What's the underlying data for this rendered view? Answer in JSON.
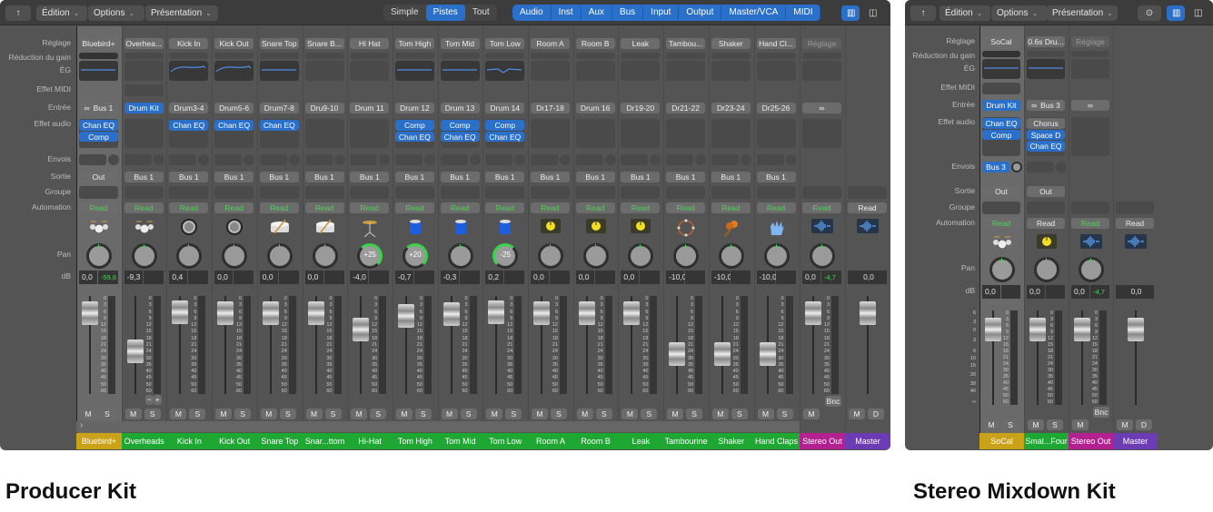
{
  "colors": {
    "accent": "#2a6fc9",
    "read_green": "#52d05a",
    "track_green": "#1fa733",
    "selected_gold": "#c9a21a",
    "output_magenta": "#b3208f",
    "master_purple": "#6c3cb4"
  },
  "row_labels": {
    "setting": "Réglage",
    "gain": "Réduction du gain",
    "eq": "ÉG",
    "midi": "Effet MIDI",
    "input": "Entrée",
    "fx": "Effet audio",
    "sends": "Envois",
    "output": "Sortie",
    "group": "Groupe",
    "automation": "Automation",
    "pan": "Pan",
    "db": "dB"
  },
  "meter_scale": [
    "0",
    "3",
    "6",
    "9",
    "12",
    "15",
    "18",
    "21",
    "24",
    "30",
    "35",
    "40",
    "45",
    "50",
    "60"
  ],
  "fader_scale": [
    "6",
    "3",
    "0",
    "3",
    "6",
    "10",
    "15",
    "20",
    "30",
    "40",
    "∞"
  ],
  "producer": {
    "caption": "Producer Kit",
    "toolbar": {
      "back_icon": "back-arrow-icon",
      "menus": [
        "Édition",
        "Options",
        "Présentation"
      ],
      "views": [
        "Simple",
        "Pistes",
        "Tout"
      ],
      "active_view": "Pistes",
      "filters": [
        "Audio",
        "Inst",
        "Aux",
        "Bus",
        "Input",
        "Output",
        "Master/VCA",
        "MIDI"
      ]
    },
    "pm_buttons": [
      "−",
      "+"
    ],
    "expand_icon": "›",
    "strips": [
      {
        "name": "Bluebird+",
        "setting": "Bluebird+",
        "eq": "flat",
        "input": "Bus 1",
        "link": true,
        "fx": [
          {
            "l": "Chan EQ",
            "b": 1
          },
          {
            "l": "Comp",
            "b": 1
          }
        ],
        "sends": true,
        "output": "Out",
        "auto": "Read",
        "icon": "drum-kit",
        "db": "0,0",
        "peak": "-59,6",
        "fader": 0,
        "btns": [
          "M",
          "S"
        ],
        "color": "#c9a21a",
        "sel": true
      },
      {
        "name": "Overheads",
        "setting": "Overhea...",
        "midi": true,
        "input": "Drum Kit",
        "inputBlue": true,
        "fx": [],
        "sends": true,
        "output": "Bus 1",
        "auto": "Read",
        "icon": "drum-kit",
        "db": "-9,3",
        "fader": -9.3,
        "btns": [
          "M",
          "S"
        ],
        "color": "#1fa733",
        "pm": true
      },
      {
        "name": "Kick In",
        "setting": "Kick In",
        "eq": "curve",
        "input": "Drum3-4",
        "fx": [
          {
            "l": "Chan EQ",
            "b": 1
          }
        ],
        "sends": true,
        "output": "Bus 1",
        "auto": "Read",
        "icon": "kick-drum",
        "db": "0,4",
        "fader": 0.4,
        "btns": [
          "M",
          "S"
        ],
        "color": "#1fa733"
      },
      {
        "name": "Kick Out",
        "setting": "Kick Out",
        "eq": "curve",
        "input": "Drum5-6",
        "fx": [
          {
            "l": "Chan EQ",
            "b": 1
          }
        ],
        "sends": true,
        "output": "Bus 1",
        "auto": "Read",
        "icon": "kick-drum",
        "db": "0,0",
        "fader": 0,
        "btns": [
          "M",
          "S"
        ],
        "color": "#1fa733"
      },
      {
        "name": "Snare Top",
        "setting": "Snare Top",
        "eq": "flat",
        "input": "Drum7-8",
        "fx": [
          {
            "l": "Chan EQ",
            "b": 1
          }
        ],
        "sends": true,
        "output": "Bus 1",
        "auto": "Read",
        "icon": "snare-drum",
        "db": "0,0",
        "fader": 0,
        "btns": [
          "M",
          "S"
        ],
        "color": "#1fa733"
      },
      {
        "name": "Snar...ttom",
        "setting": "Snare B...",
        "input": "Dru9-10",
        "fx": [],
        "sends": true,
        "output": "Bus 1",
        "auto": "Read",
        "icon": "snare-drum",
        "db": "0,0",
        "fader": 0,
        "btns": [
          "M",
          "S"
        ],
        "color": "#1fa733"
      },
      {
        "name": "Hi-Hat",
        "setting": "Hi Hat",
        "input": "Drum 11",
        "fx": [],
        "sends": true,
        "output": "Bus 1",
        "auto": "Read",
        "icon": "hi-hat",
        "pan": 25,
        "panLabel": "+25",
        "db": "-4,0",
        "fader": -4,
        "btns": [
          "M",
          "S"
        ],
        "color": "#1fa733"
      },
      {
        "name": "Tom High",
        "setting": "Tom High",
        "eq": "flat",
        "input": "Drum 12",
        "fx": [
          {
            "l": "Comp",
            "b": 1
          },
          {
            "l": "Chan EQ",
            "b": 1
          }
        ],
        "sends": true,
        "output": "Bus 1",
        "auto": "Read",
        "icon": "tom",
        "pan": 20,
        "panLabel": "+20",
        "db": "-0,7",
        "fader": -0.7,
        "btns": [
          "M",
          "S"
        ],
        "color": "#1fa733"
      },
      {
        "name": "Tom Mid",
        "setting": "Tom Mid",
        "eq": "flat",
        "input": "Drum 13",
        "fx": [
          {
            "l": "Comp",
            "b": 1
          },
          {
            "l": "Chan EQ",
            "b": 1
          }
        ],
        "sends": true,
        "output": "Bus 1",
        "auto": "Read",
        "icon": "tom",
        "db": "-0,3",
        "fader": -0.3,
        "btns": [
          "M",
          "S"
        ],
        "color": "#1fa733"
      },
      {
        "name": "Tom Low",
        "setting": "Tom Low",
        "eq": "dip",
        "input": "Drum 14",
        "fx": [
          {
            "l": "Comp",
            "b": 1
          },
          {
            "l": "Chan EQ",
            "b": 1
          }
        ],
        "sends": true,
        "output": "Bus 1",
        "auto": "Read",
        "icon": "tom",
        "pan": -25,
        "panLabel": "-25",
        "db": "0,2",
        "fader": 0.2,
        "btns": [
          "M",
          "S"
        ],
        "color": "#1fa733"
      },
      {
        "name": "Room A",
        "setting": "Room A",
        "input": "Dr17-18",
        "fx": [],
        "sends": true,
        "output": "Bus 1",
        "auto": "Read",
        "icon": "room-mic",
        "db": "0,0",
        "fader": 0,
        "btns": [
          "M",
          "S"
        ],
        "color": "#1fa733"
      },
      {
        "name": "Room B",
        "setting": "Room B",
        "input": "Drum 16",
        "fx": [],
        "sends": true,
        "output": "Bus 1",
        "auto": "Read",
        "icon": "room-mic",
        "db": "0,0",
        "fader": 0,
        "btns": [
          "M",
          "S"
        ],
        "color": "#1fa733"
      },
      {
        "name": "Leak",
        "setting": "Leak",
        "input": "Dr19-20",
        "fx": [],
        "sends": true,
        "output": "Bus 1",
        "auto": "Read",
        "icon": "room-mic",
        "db": "0,0",
        "fader": 0,
        "btns": [
          "M",
          "S"
        ],
        "color": "#1fa733"
      },
      {
        "name": "Tambourine",
        "setting": "Tambou...",
        "input": "Dr21-22",
        "fx": [],
        "sends": true,
        "output": "Bus 1",
        "auto": "Read",
        "icon": "tambourine",
        "db": "-10,0",
        "fader": -10,
        "btns": [
          "M",
          "S"
        ],
        "color": "#1fa733"
      },
      {
        "name": "Shaker",
        "setting": "Shaker",
        "input": "Dr23-24",
        "fx": [],
        "sends": true,
        "output": "Bus 1",
        "auto": "Read",
        "icon": "shaker",
        "db": "-10,0",
        "fader": -10,
        "btns": [
          "M",
          "S"
        ],
        "color": "#1fa733"
      },
      {
        "name": "Hand Claps",
        "setting": "Hand Cl...",
        "input": "Dr25-26",
        "fx": [],
        "sends": true,
        "output": "Bus 1",
        "auto": "Read",
        "icon": "hand-clap",
        "db": "-10,0",
        "fader": -10,
        "btns": [
          "M",
          "S"
        ],
        "color": "#1fa733"
      },
      {
        "name": "Stereo Out",
        "setting": "Réglage",
        "settingDim": true,
        "link": true,
        "input": "",
        "fx": [],
        "auto": "Read",
        "icon": "waveform",
        "db": "0,0",
        "peak": "-4,7",
        "fader": 0,
        "btns": [
          "M"
        ],
        "bnc": "Bnc",
        "color": "#b3208f",
        "out": true
      },
      {
        "name": "Master",
        "noSetting": true,
        "noInput": true,
        "nofx": true,
        "auto": "Read",
        "autoGray": true,
        "icon": "waveform",
        "noPan": true,
        "db": "0,0",
        "single": true,
        "fader": 0,
        "btns": [
          "M",
          "D"
        ],
        "color": "#6c3cb4",
        "out": true
      }
    ]
  },
  "mixdown": {
    "caption": "Stereo Mixdown Kit",
    "toolbar": {
      "back_icon": "back-arrow-icon",
      "menus": [
        "Édition",
        "Options",
        "Présentation"
      ],
      "more_icon": "ellipsis-circle-icon"
    },
    "strips": [
      {
        "name": "SoCal",
        "setting": "SoCal",
        "eq": "flat",
        "midi": true,
        "input": "Drum Kit",
        "inputBlue": true,
        "fx": [
          {
            "l": "Chan EQ",
            "b": 1
          },
          {
            "l": "Comp",
            "b": 1
          }
        ],
        "send": "Bus 3",
        "output": "Out",
        "auto": "Read",
        "icon": "drum-kit",
        "db": "0,0",
        "fader": 0,
        "btns": [
          "M",
          "S"
        ],
        "color": "#c9a21a",
        "sel": true,
        "scale": true
      },
      {
        "name": "Smal...Four",
        "setting": "0.6s Dru...",
        "eq": "flat",
        "link": true,
        "input": "Bus 3",
        "fx": [
          {
            "l": "Chorus",
            "b": 0
          },
          {
            "l": "Space D",
            "b": 1
          },
          {
            "l": "Chan EQ",
            "b": 1
          }
        ],
        "sends": true,
        "output": "Out",
        "auto": "Read",
        "autoGray": true,
        "icon": "room-mic",
        "db": "0,0",
        "fader": 0,
        "btns": [
          "M",
          "S"
        ],
        "color": "#1fa733"
      },
      {
        "name": "Stereo Out",
        "setting": "Réglage",
        "settingDim": true,
        "link": true,
        "input": "",
        "fx": [],
        "auto": "Read",
        "icon": "waveform",
        "db": "0,0",
        "peak": "-4,7",
        "fader": 0,
        "btns": [
          "M"
        ],
        "bnc": "Bnc",
        "color": "#b3208f",
        "out": true
      },
      {
        "name": "Master",
        "noSetting": true,
        "noInput": true,
        "nofx": true,
        "auto": "Read",
        "autoGray": true,
        "icon": "waveform",
        "noPan": true,
        "db": "0,0",
        "single": true,
        "fader": 0,
        "btns": [
          "M",
          "D"
        ],
        "color": "#6c3cb4",
        "out": true
      }
    ]
  }
}
